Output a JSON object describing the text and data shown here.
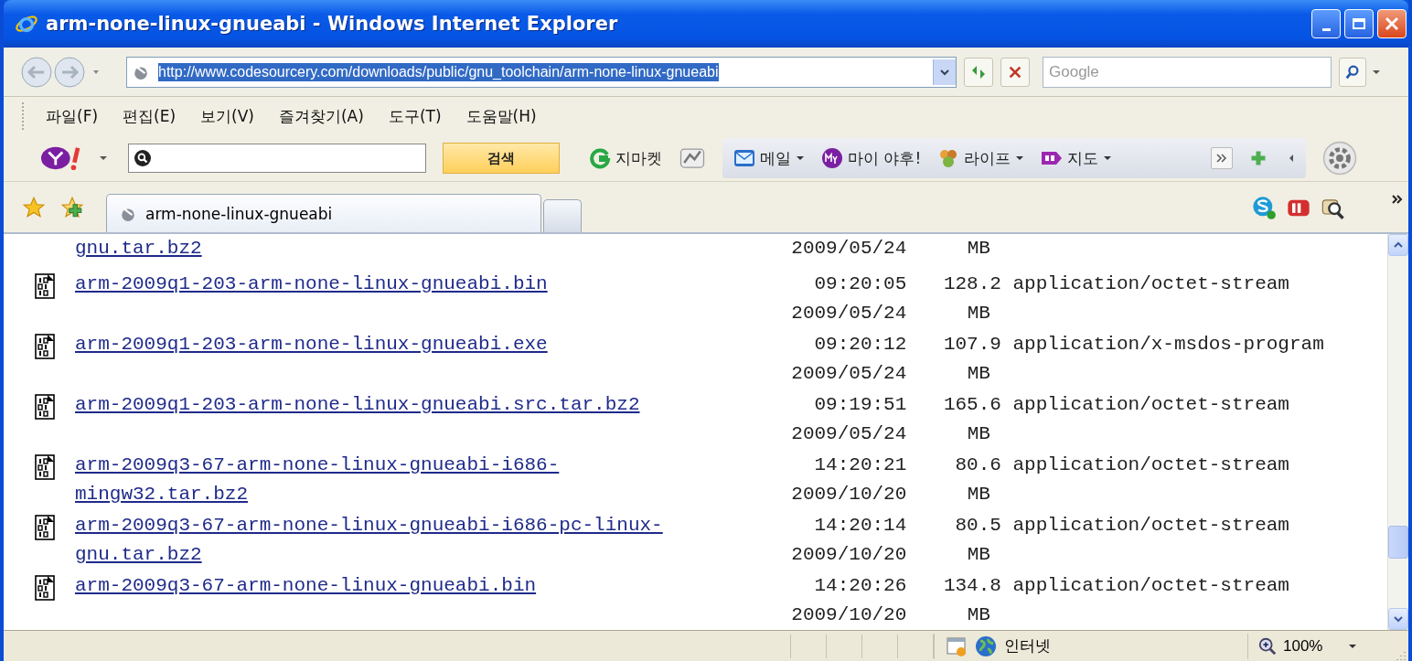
{
  "window": {
    "title": "arm-none-linux-gnueabi - Windows Internet Explorer"
  },
  "address_bar": {
    "url": "http://www.codesourcery.com/downloads/public/gnu_toolchain/arm-none-linux-gnueabi",
    "selected": true
  },
  "search_box": {
    "placeholder": "Google"
  },
  "menu": [
    "파일(F)",
    "편집(E)",
    "보기(V)",
    "즐겨찾기(A)",
    "도구(T)",
    "도움말(H)"
  ],
  "yahoo_toolbar": {
    "search_button": "검색",
    "links": [
      {
        "label": "지마켓",
        "kind": "gmarket",
        "dropdown": false
      },
      {
        "label": "메일",
        "kind": "mail",
        "dropdown": true
      },
      {
        "label": "마이 야후!",
        "kind": "my",
        "dropdown": false
      },
      {
        "label": "라이프",
        "kind": "life",
        "dropdown": true
      },
      {
        "label": "지도",
        "kind": "map",
        "dropdown": true
      }
    ]
  },
  "tabs": [
    {
      "label": "arm-none-linux-gnueabi",
      "selected": true
    }
  ],
  "files": [
    {
      "kind": "continued",
      "name": "gnu.tar.bz2",
      "date": "2009/05/24",
      "unit": "MB"
    },
    {
      "kind": "file",
      "name": "arm-2009q1-203-arm-none-linux-gnueabi.bin",
      "time": "09:20:05",
      "date": "2009/05/24",
      "size": "128.2",
      "unit": "MB",
      "type": "application/octet-stream"
    },
    {
      "kind": "file",
      "name": "arm-2009q1-203-arm-none-linux-gnueabi.exe",
      "time": "09:20:12",
      "date": "2009/05/24",
      "size": "107.9",
      "unit": "MB",
      "type": "application/x-msdos-program"
    },
    {
      "kind": "file",
      "name": "arm-2009q1-203-arm-none-linux-gnueabi.src.tar.bz2",
      "time": "09:19:51",
      "date": "2009/05/24",
      "size": "165.6",
      "unit": "MB",
      "type": "application/octet-stream"
    },
    {
      "kind": "file",
      "name": "arm-2009q3-67-arm-none-linux-gnueabi-i686-mingw32.tar.bz2",
      "time": "14:20:21",
      "date": "2009/10/20",
      "size": "80.6",
      "unit": "MB",
      "type": "application/octet-stream"
    },
    {
      "kind": "file",
      "name": "arm-2009q3-67-arm-none-linux-gnueabi-i686-pc-linux-gnu.tar.bz2",
      "time": "14:20:14",
      "date": "2009/10/20",
      "size": "80.5",
      "unit": "MB",
      "type": "application/octet-stream"
    },
    {
      "kind": "file",
      "name": "arm-2009q3-67-arm-none-linux-gnueabi.bin",
      "time": "14:20:26",
      "date": "2009/10/20",
      "size": "134.8",
      "unit": "MB",
      "type": "application/octet-stream"
    }
  ],
  "status_bar": {
    "zone": "인터넷",
    "zoom": "100%"
  }
}
